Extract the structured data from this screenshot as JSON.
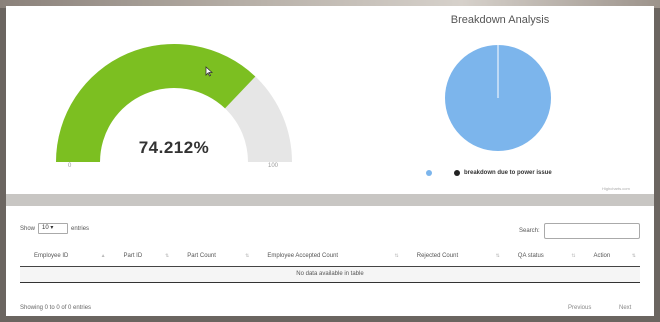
{
  "gauge": {
    "value_label": "74.212%",
    "value": 74.212,
    "min_label": "0",
    "max_label": "100",
    "fill_color": "#7cbf21",
    "track_color": "#e6e6e6"
  },
  "pie": {
    "title": "Breakdown Analysis",
    "slice_color": "#7cb5ec",
    "legend_label": "breakdown due to power issue",
    "credits": "Highcharts.com"
  },
  "table": {
    "length_prefix": "Show",
    "length_value": "10",
    "length_suffix": "entries",
    "search_label": "Search:",
    "columns": [
      "Employee ID",
      "Part ID",
      "Part Count",
      "Employee Accepted Count",
      "Rejected Count",
      "QA status",
      "Action"
    ],
    "empty_message": "No data available in table",
    "info": "Showing 0 to 0 of 0 entries",
    "prev_label": "Previous",
    "next_label": "Next"
  }
}
